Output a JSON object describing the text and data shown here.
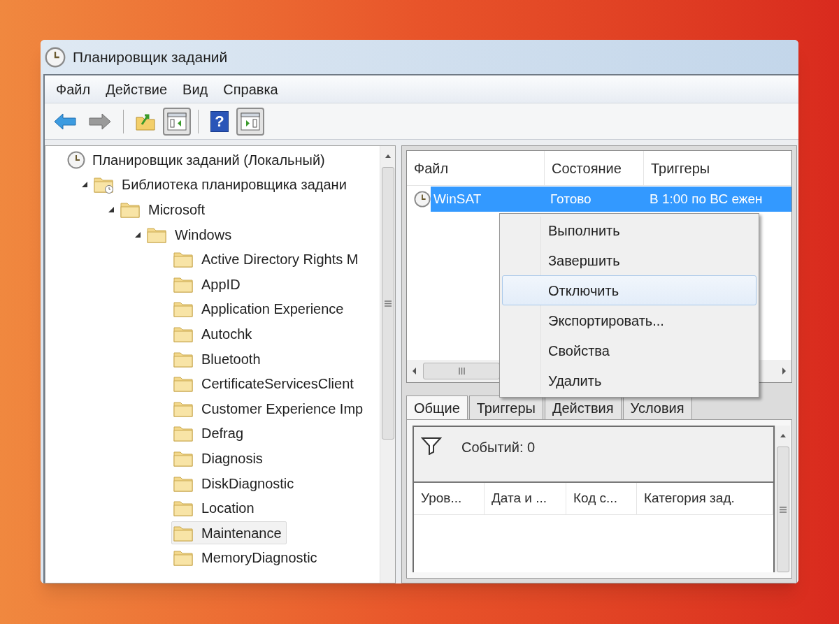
{
  "window": {
    "title": "Планировщик заданий"
  },
  "menu": [
    "Файл",
    "Действие",
    "Вид",
    "Справка"
  ],
  "toolbar": [
    {
      "kind": "back",
      "pressed": false
    },
    {
      "kind": "forward",
      "pressed": false
    },
    {
      "kind": "separator"
    },
    {
      "kind": "folder-up",
      "pressed": false
    },
    {
      "kind": "panel-left",
      "pressed": true
    },
    {
      "kind": "separator"
    },
    {
      "kind": "help",
      "label": "?",
      "pressed": false
    },
    {
      "kind": "panel-right",
      "pressed": true
    }
  ],
  "tree": [
    {
      "label": "Планировщик заданий (Локальный)",
      "kind": "scheduler",
      "selected": false,
      "children": [
        {
          "label": "Библиотека планировщика задани",
          "kind": "library",
          "expanded": true,
          "selected": false,
          "children": [
            {
              "label": "Microsoft",
              "kind": "folder",
              "expanded": true,
              "selected": false,
              "children": [
                {
                  "label": "Windows",
                  "kind": "folder",
                  "expanded": true,
                  "selected": false,
                  "children": [
                    {
                      "label": "Active Directory Rights M",
                      "kind": "folder",
                      "selected": false
                    },
                    {
                      "label": "AppID",
                      "kind": "folder",
                      "selected": false
                    },
                    {
                      "label": "Application Experience",
                      "kind": "folder",
                      "selected": false
                    },
                    {
                      "label": "Autochk",
                      "kind": "folder",
                      "selected": false
                    },
                    {
                      "label": "Bluetooth",
                      "kind": "folder",
                      "selected": false
                    },
                    {
                      "label": "CertificateServicesClient",
                      "kind": "folder",
                      "selected": false
                    },
                    {
                      "label": "Customer Experience Imp",
                      "kind": "folder",
                      "selected": false
                    },
                    {
                      "label": "Defrag",
                      "kind": "folder",
                      "selected": false
                    },
                    {
                      "label": "Diagnosis",
                      "kind": "folder",
                      "selected": false
                    },
                    {
                      "label": "DiskDiagnostic",
                      "kind": "folder",
                      "selected": false
                    },
                    {
                      "label": "Location",
                      "kind": "folder",
                      "selected": false
                    },
                    {
                      "label": "Maintenance",
                      "kind": "folder",
                      "selected": true
                    },
                    {
                      "label": "MemoryDiagnostic",
                      "kind": "folder",
                      "selected": false
                    }
                  ]
                }
              ]
            }
          ]
        }
      ]
    }
  ],
  "task_list": {
    "columns": [
      "Файл",
      "Состояние",
      "Триггеры"
    ],
    "rows": [
      {
        "cells": [
          "WinSAT",
          "Готово",
          "В 1:00 по ВС ежен"
        ],
        "selected": true
      }
    ]
  },
  "context_menu": [
    {
      "label": "Выполнить",
      "selected": false
    },
    {
      "label": "Завершить",
      "selected": false
    },
    {
      "label": "Отключить",
      "selected": true
    },
    {
      "label": "Экспортировать...",
      "selected": false
    },
    {
      "label": "Свойства",
      "selected": false
    },
    {
      "label": "Удалить",
      "selected": false
    }
  ],
  "tabs": [
    {
      "label": "Общие",
      "selected": true
    },
    {
      "label": "Триггеры",
      "selected": false
    },
    {
      "label": "Действия",
      "selected": false
    },
    {
      "label": "Условия",
      "selected": false
    }
  ],
  "history": {
    "count": "Событий: 0",
    "columns": [
      "Уров...",
      "Дата и ...",
      "Код с...",
      "Категория зад."
    ]
  }
}
